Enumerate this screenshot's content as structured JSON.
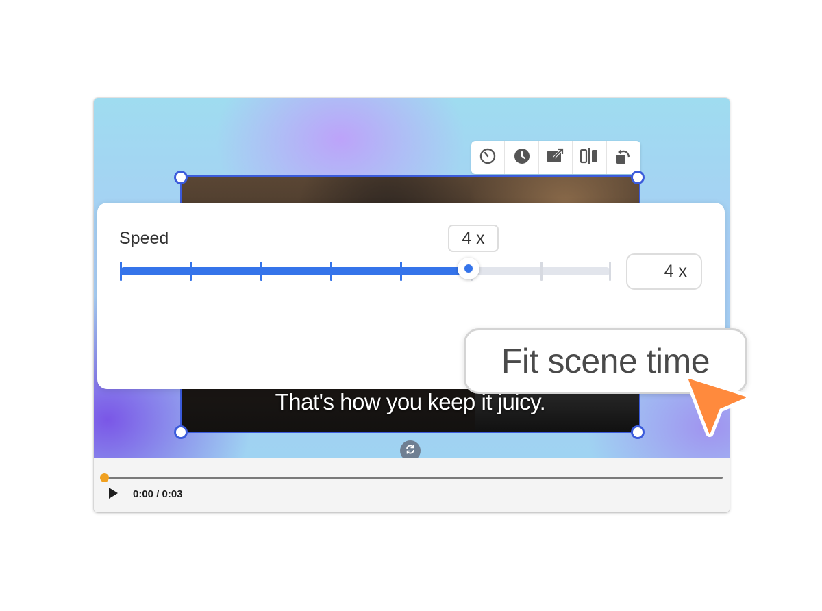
{
  "video": {
    "caption": "That's how you keep it juicy."
  },
  "toolbar": {
    "tools": [
      {
        "name": "speed-icon"
      },
      {
        "name": "clock-icon"
      },
      {
        "name": "replace-icon"
      },
      {
        "name": "split-icon"
      },
      {
        "name": "rotate-icon"
      }
    ]
  },
  "playback": {
    "time": "0:00 / 0:03",
    "progress": 0.0,
    "accent": "#f0a020"
  },
  "speed": {
    "label": "Speed",
    "value_display": "4 x",
    "input_value": "4 x",
    "steps": 7,
    "selected_step": 5,
    "accent": "#3574ea"
  },
  "fit_button": {
    "label": "Fit scene time"
  },
  "colors": {
    "selection": "#3b5bdb",
    "cursor": "#ff8a3d"
  }
}
